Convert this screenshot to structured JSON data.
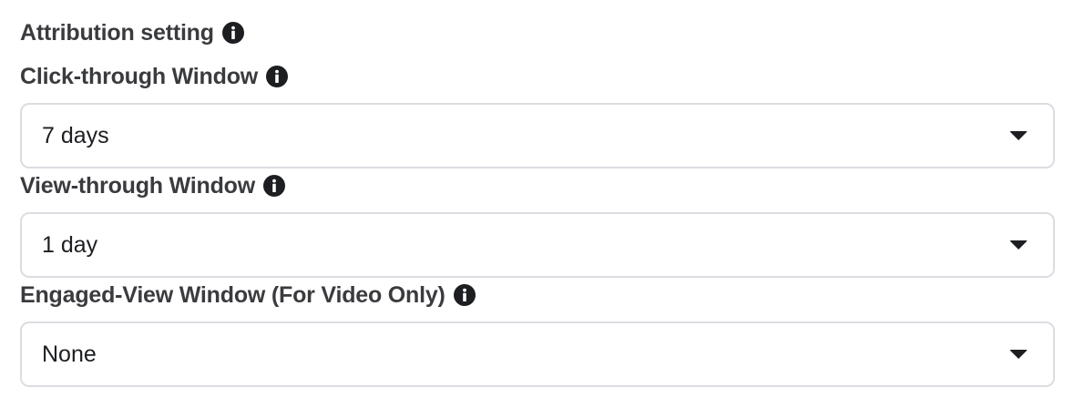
{
  "attribution": {
    "title": "Attribution setting"
  },
  "click_through": {
    "label": "Click-through Window",
    "value": "7 days"
  },
  "view_through": {
    "label": "View-through Window",
    "value": "1 day"
  },
  "engaged_view": {
    "label": "Engaged-View Window (For Video Only)",
    "value": "None"
  },
  "icons": {
    "info": "info-icon",
    "dropdown": "caret-down-icon"
  }
}
